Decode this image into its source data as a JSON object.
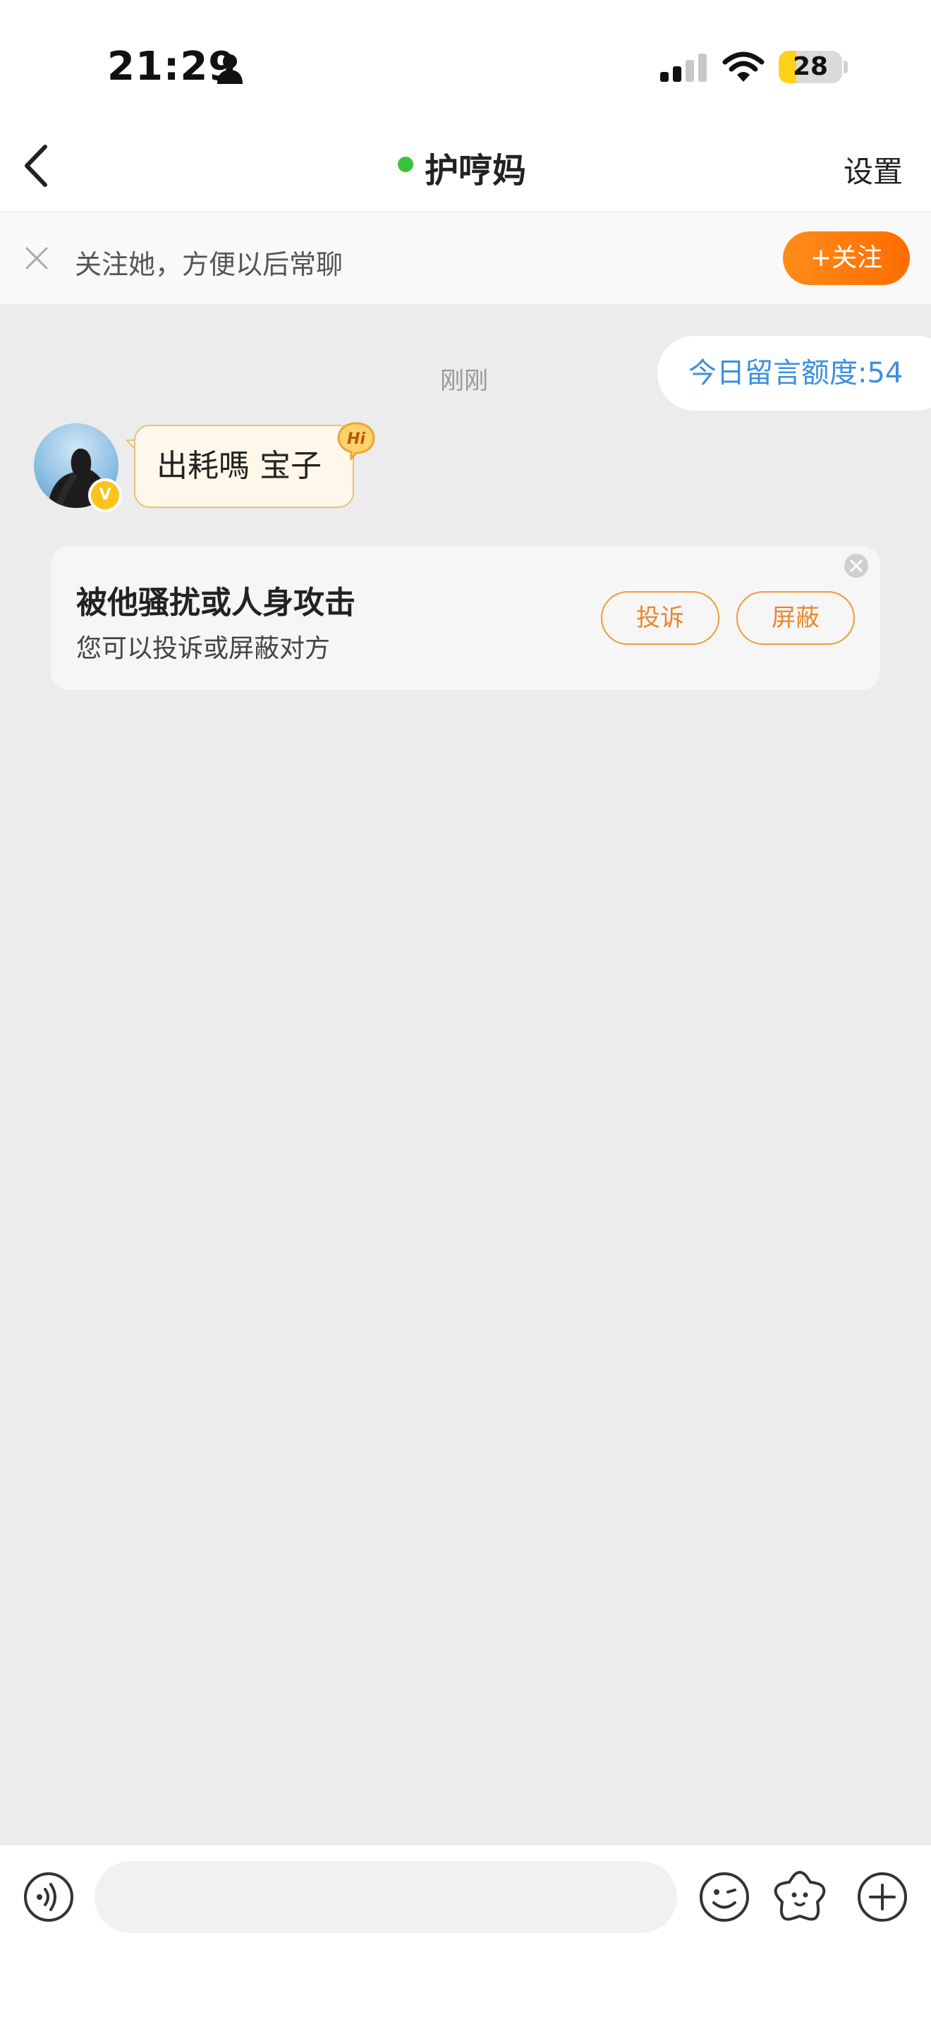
{
  "status_bar": {
    "time": "21:29",
    "battery_level": "28",
    "battery_fraction": 0.28,
    "icons": [
      "person-icon",
      "cellular-signal-icon",
      "wifi-icon",
      "battery-icon"
    ]
  },
  "nav": {
    "title": "护哼妈",
    "online": true,
    "settings_label": "设置",
    "back_icon": "chevron-left-icon"
  },
  "follow_banner": {
    "text": "关注她，方便以后常聊",
    "button_label": "+关注"
  },
  "chat": {
    "quota_label": "今日留言额度:54",
    "timestamp": "刚刚",
    "messages": [
      {
        "sender": "other",
        "text": "出耗嗎 宝子",
        "badge": "Hi"
      }
    ],
    "verify_badge": "V"
  },
  "report_card": {
    "title": "被他骚扰或人身攻击",
    "subtitle": "您可以投诉或屏蔽对方",
    "complain_label": "投诉",
    "block_label": "屏蔽"
  },
  "composer": {
    "placeholder": "",
    "icons": [
      "voice-icon",
      "emoji-icon",
      "sticker-icon",
      "plus-icon"
    ]
  },
  "colors": {
    "accent_orange": "#ff7a00",
    "online_green": "#38c23c",
    "quota_blue": "#3d8fe0",
    "chat_background": "#ececec"
  }
}
